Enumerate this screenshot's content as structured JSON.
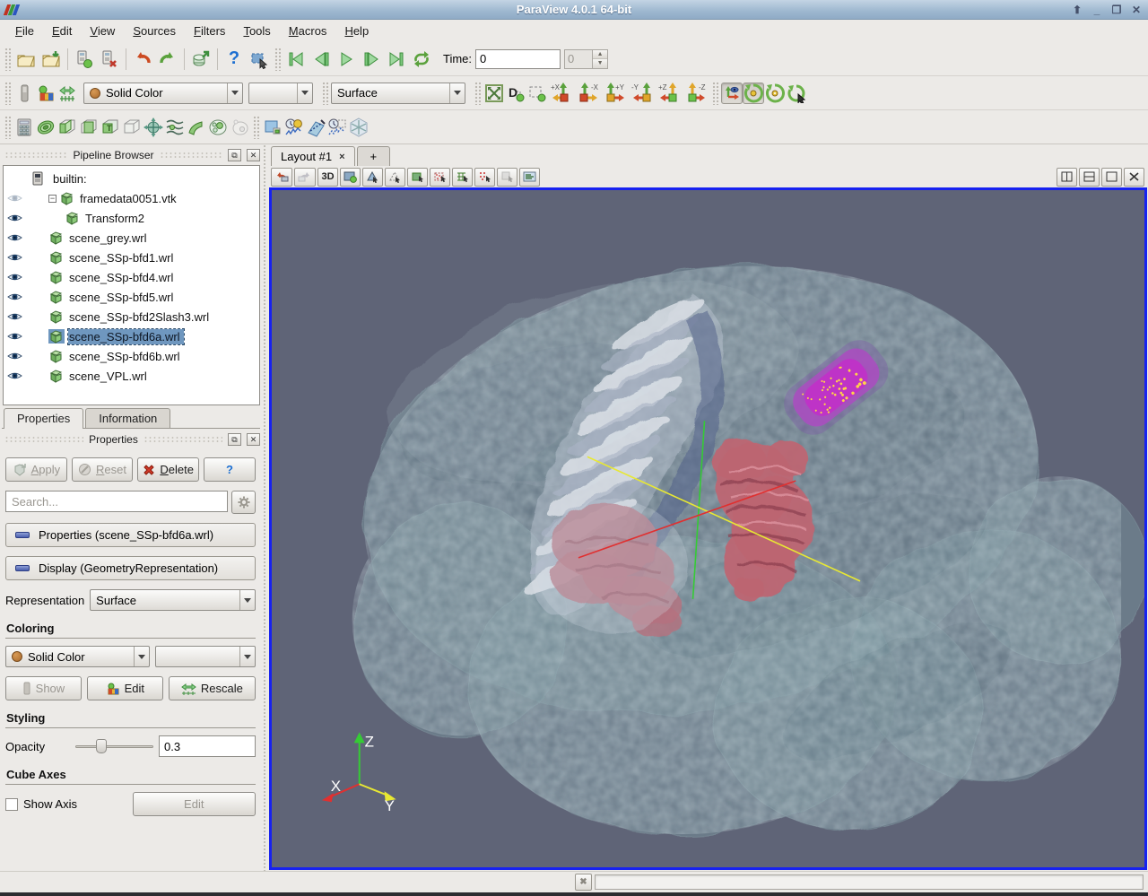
{
  "window": {
    "title": "ParaView 4.0.1 64-bit",
    "shade": "⬆",
    "minimize": "_",
    "restore": "❐",
    "close": "✕"
  },
  "menu": {
    "items": [
      "File",
      "Edit",
      "View",
      "Sources",
      "Filters",
      "Tools",
      "Macros",
      "Help"
    ]
  },
  "toolbar1": {
    "time_label": "Time:",
    "time_value": "0",
    "frame_value": "0",
    "help_glyph": "?"
  },
  "toolbar2": {
    "color_mode": "Solid Color",
    "array_value": "",
    "representation": "Surface",
    "cam_axes": [
      "+X",
      "-X",
      "+Y",
      "-Y",
      "+Z",
      "-Z"
    ]
  },
  "layout": {
    "tab_label": "Layout #1",
    "tab_close": "×",
    "new_tab": "+",
    "view3d": "3D"
  },
  "pipeline": {
    "title": "Pipeline Browser",
    "items": [
      {
        "label": "builtin:",
        "depth": 0,
        "icon": "server",
        "eye": "none",
        "selected": false,
        "expander": false
      },
      {
        "label": "framedata0051.vtk",
        "depth": 1,
        "icon": "cube",
        "eye": "dim",
        "selected": false,
        "expander": true
      },
      {
        "label": "Transform2",
        "depth": 2,
        "icon": "cube",
        "eye": "on",
        "selected": false,
        "expander": false
      },
      {
        "label": "scene_grey.wrl",
        "depth": 1,
        "icon": "cube",
        "eye": "on",
        "selected": false,
        "expander": false
      },
      {
        "label": "scene_SSp-bfd1.wrl",
        "depth": 1,
        "icon": "cube",
        "eye": "on",
        "selected": false,
        "expander": false
      },
      {
        "label": "scene_SSp-bfd4.wrl",
        "depth": 1,
        "icon": "cube",
        "eye": "on",
        "selected": false,
        "expander": false
      },
      {
        "label": "scene_SSp-bfd5.wrl",
        "depth": 1,
        "icon": "cube",
        "eye": "on",
        "selected": false,
        "expander": false
      },
      {
        "label": "scene_SSp-bfd2Slash3.wrl",
        "depth": 1,
        "icon": "cube",
        "eye": "on",
        "selected": false,
        "expander": false
      },
      {
        "label": "scene_SSp-bfd6a.wrl",
        "depth": 1,
        "icon": "cube",
        "eye": "on",
        "selected": true,
        "expander": false
      },
      {
        "label": "scene_SSp-bfd6b.wrl",
        "depth": 1,
        "icon": "cube",
        "eye": "on",
        "selected": false,
        "expander": false
      },
      {
        "label": "scene_VPL.wrl",
        "depth": 1,
        "icon": "cube",
        "eye": "on",
        "selected": false,
        "expander": false
      }
    ]
  },
  "tabs": {
    "properties": "Properties",
    "information": "Information"
  },
  "properties": {
    "dock_title": "Properties",
    "apply": "Apply",
    "reset": "Reset",
    "delete": "Delete",
    "help": "?",
    "search_placeholder": "Search...",
    "section_properties": "Properties (scene_SSp-bfd6a.wrl)",
    "section_display": "Display (GeometryRepresentation)",
    "representation_label": "Representation",
    "representation_value": "Surface",
    "coloring_heading": "Coloring",
    "color_mode": "Solid Color",
    "show": "Show",
    "edit": "Edit",
    "rescale": "Rescale",
    "styling_heading": "Styling",
    "opacity_label": "Opacity",
    "opacity_value": "0.3",
    "cube_axes_heading": "Cube Axes",
    "show_axis_label": "Show Axis",
    "cube_edit": "Edit"
  },
  "viewport": {
    "axis_x": "X",
    "axis_y": "Y",
    "axis_z": "Z"
  },
  "colors": {
    "selection": "#6f97bf",
    "viewport_background": "#5f6477",
    "focus_border": "#1722f0",
    "brain_surface": "#7a949c",
    "structure_pink": "#bd6572",
    "structure_purple": "#b43cc4",
    "dots_yellow": "#ffd24a",
    "axis_x_red": "#e03030",
    "axis_y_yellow": "#e8e833",
    "axis_z_green": "#35cb35",
    "titlebar_top": "#c3d4e4",
    "titlebar_bottom": "#8fabc6"
  }
}
